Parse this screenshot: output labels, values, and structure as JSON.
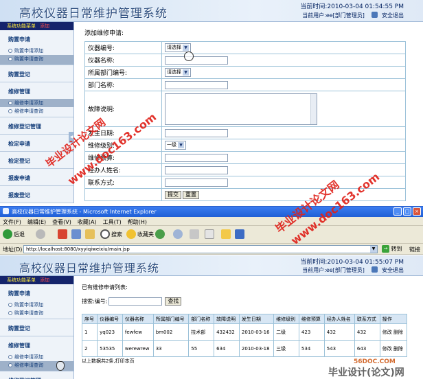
{
  "app": {
    "title": "高校仪器日常维护管理系统",
    "current_time_top": "当前时间:2010-03-04 01:54:55 PM",
    "current_time_bottom": "当前时间:2010-03-04 01:55:07 PM",
    "current_user": "当前用户:ee[部门管理员]",
    "logout": "安全退出"
  },
  "sidebar": {
    "menu_title": "系统功能菜单",
    "menu_extra": "添加",
    "sections": [
      {
        "title": "购置申请",
        "items": [
          "购置申请添加",
          "购置申请查询"
        ]
      },
      {
        "title": "购置登记",
        "items": []
      },
      {
        "title": "维修管理",
        "items": [
          "维修申请添加",
          "维修申请查询"
        ]
      },
      {
        "title": "维修登记管理",
        "items": []
      },
      {
        "title": "检定申请",
        "items": []
      },
      {
        "title": "检定登记",
        "items": []
      },
      {
        "title": "报废申请",
        "items": []
      },
      {
        "title": "报废登记",
        "items": []
      }
    ]
  },
  "form": {
    "caption": "添加维修申请:",
    "rows": {
      "instrument_no": "仪器编号:",
      "instrument_name": "仪器名称:",
      "dept_no": "所属部门编号:",
      "dept_name": "部门名称:",
      "fault_desc": "故障说明:",
      "occur_date": "发生日期:",
      "level": "维修级别:",
      "budget": "维修预算:",
      "handler": "经办人姓名:",
      "contact": "联系方式:"
    },
    "select_placeholder": "请选择",
    "level_value": "一级",
    "submit": "提交",
    "reset": "重置"
  },
  "browser": {
    "window_title": "高校仪器日常维护管理系统 - Microsoft Internet Explorer",
    "menu": [
      "文件(F)",
      "编辑(E)",
      "查看(V)",
      "收藏(A)",
      "工具(T)",
      "帮助(H)"
    ],
    "back": "后退",
    "search": "搜索",
    "favorites": "收藏夹",
    "address_label": "地址(D)",
    "url": "http://localhost:8080/xyyiqiweixiu/main.jsp",
    "go": "转到",
    "links": "链接"
  },
  "list": {
    "caption": "已有维修申请列表:",
    "search_label": "搜索:编号:",
    "search_button": "查找",
    "headers": [
      "序号",
      "仪器编号",
      "仪器名称",
      "所属部门编号",
      "部门名称",
      "故障说明",
      "发生日期",
      "维修级别",
      "维修预算",
      "经办人姓名",
      "联系方式",
      "操作"
    ],
    "rows": [
      [
        "1",
        "yq023",
        "fewfew",
        "bm002",
        "技术部",
        "432432",
        "2010-03-16",
        "二级",
        "423",
        "432",
        "432",
        "修改 删除"
      ],
      [
        "2",
        "53535",
        "werewrew",
        "33",
        "55",
        "634",
        "2010-03-18",
        "三级",
        "534",
        "543",
        "643",
        "333",
        "修改 删除"
      ]
    ],
    "summary": "以上数据共2条,打印本页"
  },
  "watermarks": {
    "text1": "毕业设计论文网",
    "url": "www.doc163.com",
    "site_small": "56DOC.COM",
    "site_big": "毕业设计(论文)网"
  },
  "colors": {
    "menu_head_bg": "#15246b",
    "menu_head_text": "#ffeb3b",
    "table_border": "#9cc2d9",
    "title_bar": "#1f5fd6",
    "watermark": "#e0221b"
  }
}
